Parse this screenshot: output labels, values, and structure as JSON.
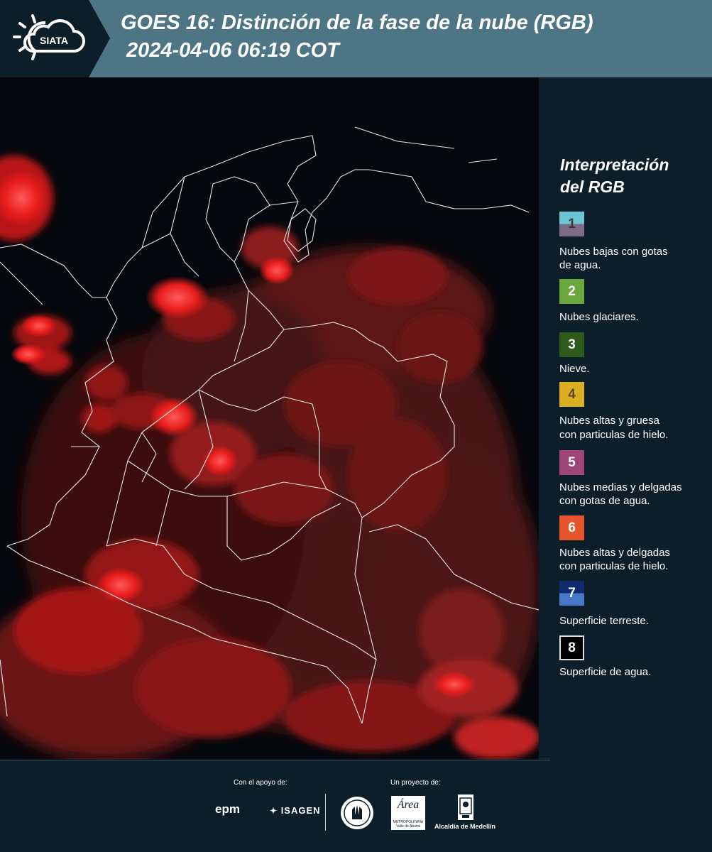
{
  "header": {
    "logo_text": "SIATA",
    "title": "GOES 16: Distinción de la fase de la nube (RGB)",
    "timestamp": "2024-04-06 06:19 COT",
    "color": "#4d7584"
  },
  "legend": {
    "title_line1": "Interpretación",
    "title_line2": "del RGB",
    "items": [
      {
        "number": "1",
        "text_lines": [
          "Nubes bajas con gotas",
          "de agua."
        ],
        "color_top": "#6ec6d4",
        "color_bottom": "#7e6b86",
        "text_color": "#3a3a3a"
      },
      {
        "number": "2",
        "text_lines": [
          "Nubes glaciares."
        ],
        "color_top": "#6aa73c",
        "color_bottom": "#6aa73c",
        "text_color": "#ffffff"
      },
      {
        "number": "3",
        "text_lines": [
          "Nieve."
        ],
        "color_top": "#2e5a1e",
        "color_bottom": "#2e5a1e",
        "text_color": "#ffffff"
      },
      {
        "number": "4",
        "text_lines": [
          "Nubes altas y gruesa",
          "con particulas de hielo."
        ],
        "color_top": "#dcae22",
        "color_bottom": "#dcae22",
        "text_color": "#5a4a20"
      },
      {
        "number": "5",
        "text_lines": [
          "Nubes medias y delgadas",
          "con gotas de agua."
        ],
        "color_top": "#a0457a",
        "color_bottom": "#a0457a",
        "text_color": "#ffffff"
      },
      {
        "number": "6",
        "text_lines": [
          "Nubes altas y delgadas",
          "con particulas de hielo."
        ],
        "color_top": "#e8542c",
        "color_bottom": "#e8542c",
        "text_color": "#ffffff"
      },
      {
        "number": "7",
        "text_lines": [
          "Superficie terreste."
        ],
        "color_top": "#0f2a6e",
        "color_bottom": "#4a78c8",
        "text_color": "#ffffff"
      },
      {
        "number": "8",
        "text_lines": [
          "Superficie de agua."
        ],
        "color_top": "#000000",
        "color_bottom": "#000000",
        "text_color": "#ffffff"
      }
    ]
  },
  "footer": {
    "support_label": "Con el apoyo de:",
    "project_label": "Un proyecto de:",
    "sponsor1": "epm",
    "sponsor2": "ISAGEN",
    "partner_area": "Área",
    "partner_area_sub1": "METROPOLITANA",
    "partner_area_sub2": "Valle de Aburrá",
    "partner_alcaldia": "Alcaldía de Medellín"
  }
}
